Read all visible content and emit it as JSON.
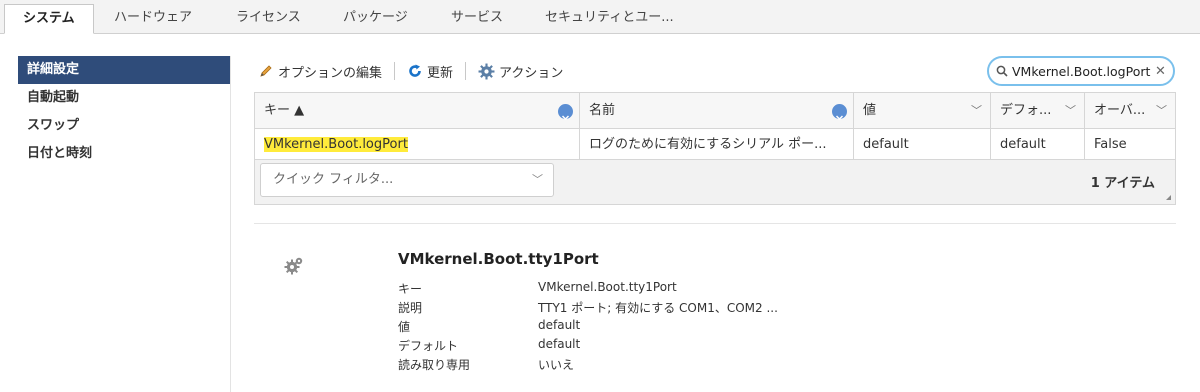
{
  "tabs": [
    {
      "label": "システム",
      "active": true
    },
    {
      "label": "ハードウェア",
      "active": false
    },
    {
      "label": "ライセンス",
      "active": false
    },
    {
      "label": "パッケージ",
      "active": false
    },
    {
      "label": "サービス",
      "active": false
    },
    {
      "label": "セキュリティとユー...",
      "active": false
    }
  ],
  "sidebar": {
    "items": [
      {
        "label": "詳細設定",
        "active": true
      },
      {
        "label": "自動起動",
        "active": false
      },
      {
        "label": "スワップ",
        "active": false
      },
      {
        "label": "日付と時刻",
        "active": false
      }
    ]
  },
  "toolbar": {
    "edit_label": "オプションの編集",
    "refresh_label": "更新",
    "actions_label": "アクション",
    "edit_icon": "pencil-icon",
    "refresh_icon": "refresh-icon",
    "actions_icon": "gear-icon"
  },
  "search": {
    "value": "VMkernel.Boot.logPort",
    "icon": "search-icon"
  },
  "grid": {
    "columns": [
      "キー ▲",
      "名前",
      "値",
      "デフォ...",
      "オーバ..."
    ],
    "rows": [
      {
        "key": "VMkernel.Boot.logPort",
        "name": "ログのために有効にするシリアル ポー...",
        "value": "default",
        "default": "default",
        "override": "False"
      }
    ],
    "quick_filter": "クイック フィルタ...",
    "count": "1 アイテム"
  },
  "detail": {
    "title": "VMkernel.Boot.tty1Port",
    "labels": {
      "key": "キー",
      "description": "説明",
      "value": "値",
      "default": "デフォルト",
      "readonly": "読み取り専用"
    },
    "values": {
      "key": "VMkernel.Boot.tty1Port",
      "description": "TTY1 ポート; 有効にする COM1、COM2 ...",
      "value": "default",
      "default": "default",
      "readonly": "いいえ"
    }
  },
  "colors": {
    "accent": "#2f4c7a",
    "highlight": "#ffeb3b",
    "search_border": "#7ac0ec",
    "refresh_icon": "#1a73c9"
  }
}
